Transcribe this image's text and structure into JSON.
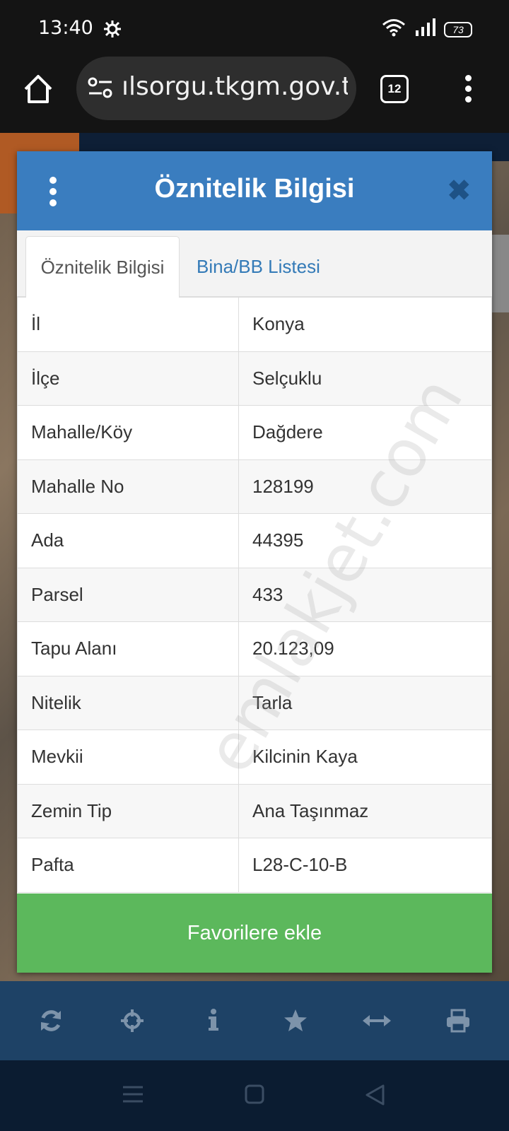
{
  "status_bar": {
    "time": "13:40",
    "battery": "73",
    "icons": [
      "settings-gear-icon",
      "wifi-icon",
      "signal-icon",
      "battery-icon"
    ]
  },
  "browser": {
    "url": "ılsorgu.tkgm.gov.tr",
    "tab_count": "12",
    "icons": [
      "home-icon",
      "site-settings-icon",
      "overflow-menu-icon"
    ]
  },
  "dialog": {
    "title": "Öznitelik Bilgisi",
    "close_glyph": "✖",
    "tabs": [
      {
        "label": "Öznitelik Bilgisi",
        "active": true
      },
      {
        "label": "Bina/BB Listesi",
        "active": false
      }
    ],
    "rows": [
      {
        "key": "İl",
        "value": "Konya"
      },
      {
        "key": "İlçe",
        "value": "Selçuklu"
      },
      {
        "key": "Mahalle/Köy",
        "value": "Dağdere"
      },
      {
        "key": "Mahalle No",
        "value": "128199"
      },
      {
        "key": "Ada",
        "value": "44395"
      },
      {
        "key": "Parsel",
        "value": "433"
      },
      {
        "key": "Tapu Alanı",
        "value": "20.123,09"
      },
      {
        "key": "Nitelik",
        "value": "Tarla"
      },
      {
        "key": "Mevkii",
        "value": "Kilcinin Kaya"
      },
      {
        "key": "Zemin Tip",
        "value": "Ana Taşınmaz"
      },
      {
        "key": "Pafta",
        "value": "L28-C-10-B"
      }
    ],
    "favorite_button": "Favorilere ekle"
  },
  "watermark": "emlakjet.com",
  "toolbar": {
    "icons": [
      "refresh-icon",
      "locate-crosshair-icon",
      "info-icon",
      "star-icon",
      "measure-arrows-icon",
      "print-icon"
    ]
  },
  "nav_bar": {
    "icons": [
      "recents-icon",
      "home-square-icon",
      "back-triangle-icon"
    ]
  },
  "colors": {
    "header_blue": "#3a7dbf",
    "button_green": "#5cb85c",
    "toolbar_blue": "#1e4266",
    "link_blue": "#337ab7"
  }
}
